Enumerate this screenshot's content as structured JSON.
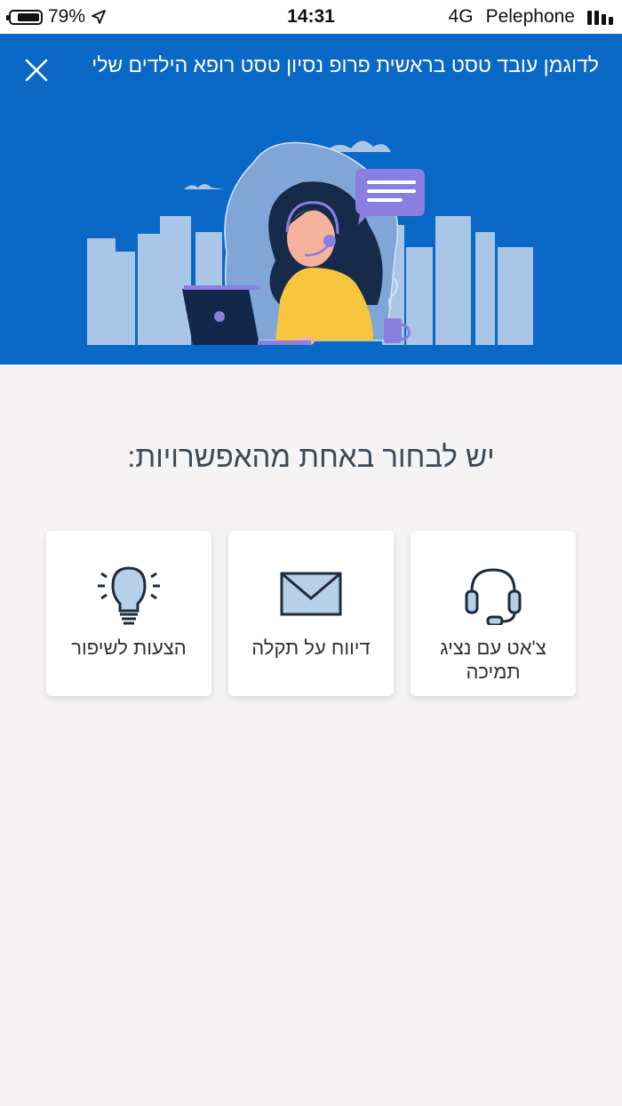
{
  "status_bar": {
    "battery": "79%",
    "time": "14:31",
    "network": "4G",
    "carrier": "Pelephone",
    "battery_level": 0.79
  },
  "header": {
    "title": "לדוגמן עובד טסט בראשית פרופ נסיון טסט רופא הילדים שלי",
    "close_icon": "close-icon",
    "background_color": "#0a68c6"
  },
  "main": {
    "prompt": "יש לבחור באחת מהאפשרויות:",
    "options": [
      {
        "label": "צ'אט עם נציג תמיכה",
        "icon": "headset-icon"
      },
      {
        "label": "דיווח על תקלה",
        "icon": "envelope-icon"
      },
      {
        "label": "הצעות לשיפור",
        "icon": "lightbulb-icon"
      }
    ]
  },
  "colors": {
    "accent": "#0a68c6",
    "text": "#3c4a58",
    "icon_fill": "#b7d0ea",
    "icon_stroke": "#1f2a3a"
  }
}
